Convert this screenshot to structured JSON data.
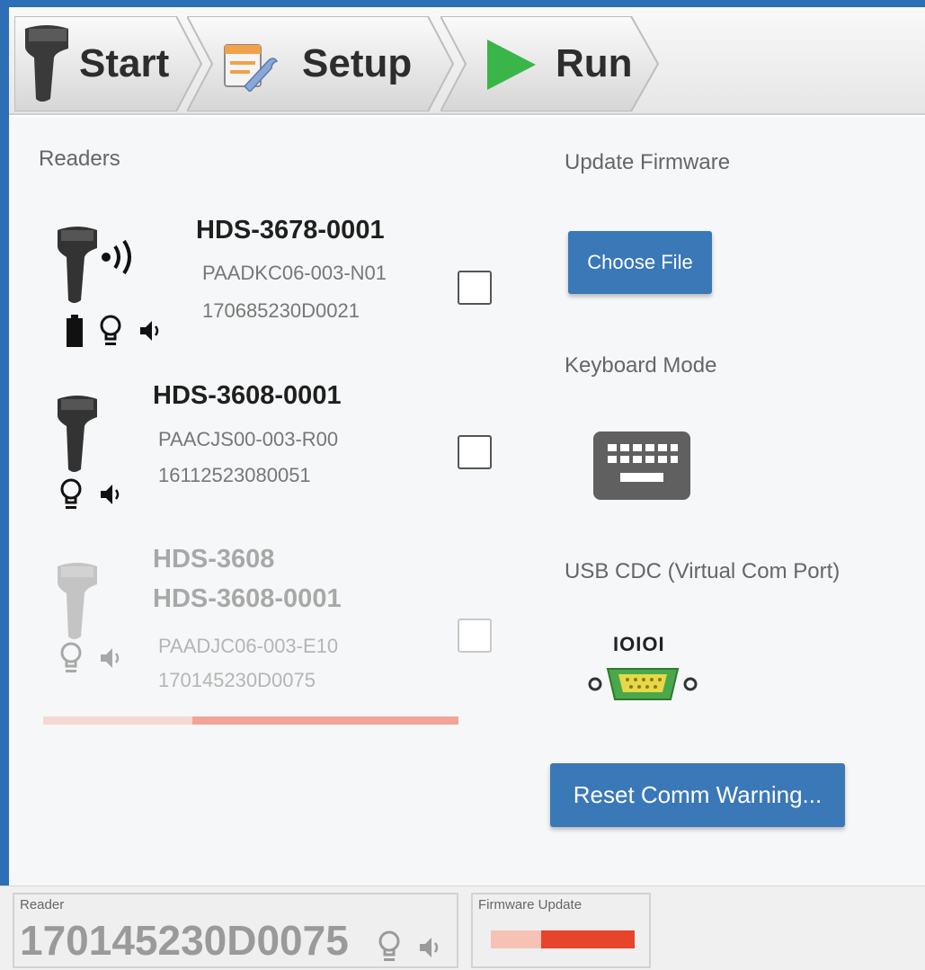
{
  "toolbar": {
    "steps": [
      {
        "label": "Start"
      },
      {
        "label": "Setup"
      },
      {
        "label": "Run"
      }
    ]
  },
  "readers_panel": {
    "title": "Readers",
    "readers": [
      {
        "name": "HDS-3678-0001",
        "part": "PAADKC06-003-N01",
        "serial": "170685230D0021",
        "checked": false,
        "wireless": true,
        "status_icons": [
          "battery-icon",
          "lightbulb-icon",
          "speaker-icon"
        ]
      },
      {
        "name": "HDS-3608-0001",
        "part": "PAACJS00-003-R00",
        "serial": "16112523080051",
        "checked": false,
        "wireless": false,
        "status_icons": [
          "lightbulb-icon",
          "speaker-icon"
        ]
      },
      {
        "model": "HDS-3608",
        "name": "HDS-3608-0001",
        "part": "PAADJC06-003-E10",
        "serial": "170145230D0075",
        "checked": false,
        "disabled": true,
        "status_icons": [
          "lightbulb-icon",
          "speaker-icon"
        ]
      }
    ],
    "update_progress": 0.64
  },
  "firmware": {
    "title": "Update Firmware",
    "choose_file_label": "Choose File"
  },
  "keyboard": {
    "title": "Keyboard Mode",
    "icon": "keyboard-icon"
  },
  "usb_cdc": {
    "title": "USB CDC (Virtual Com Port)",
    "icon_text": "IOIOI",
    "icon": "serial-port-icon"
  },
  "reset_button_label": "Reset Comm Warning...",
  "statusbar": {
    "reader_caption": "Reader",
    "reader_serial": "170145230D0075",
    "firmware_caption": "Firmware Update",
    "firmware_progress": 0.35
  },
  "colors": {
    "accent_blue": "#3a78b8",
    "progress_light": "#f5d8d2",
    "progress_mid": "#f3a49a",
    "progress_red": "#e8432b",
    "run_green": "#3ab54a"
  }
}
